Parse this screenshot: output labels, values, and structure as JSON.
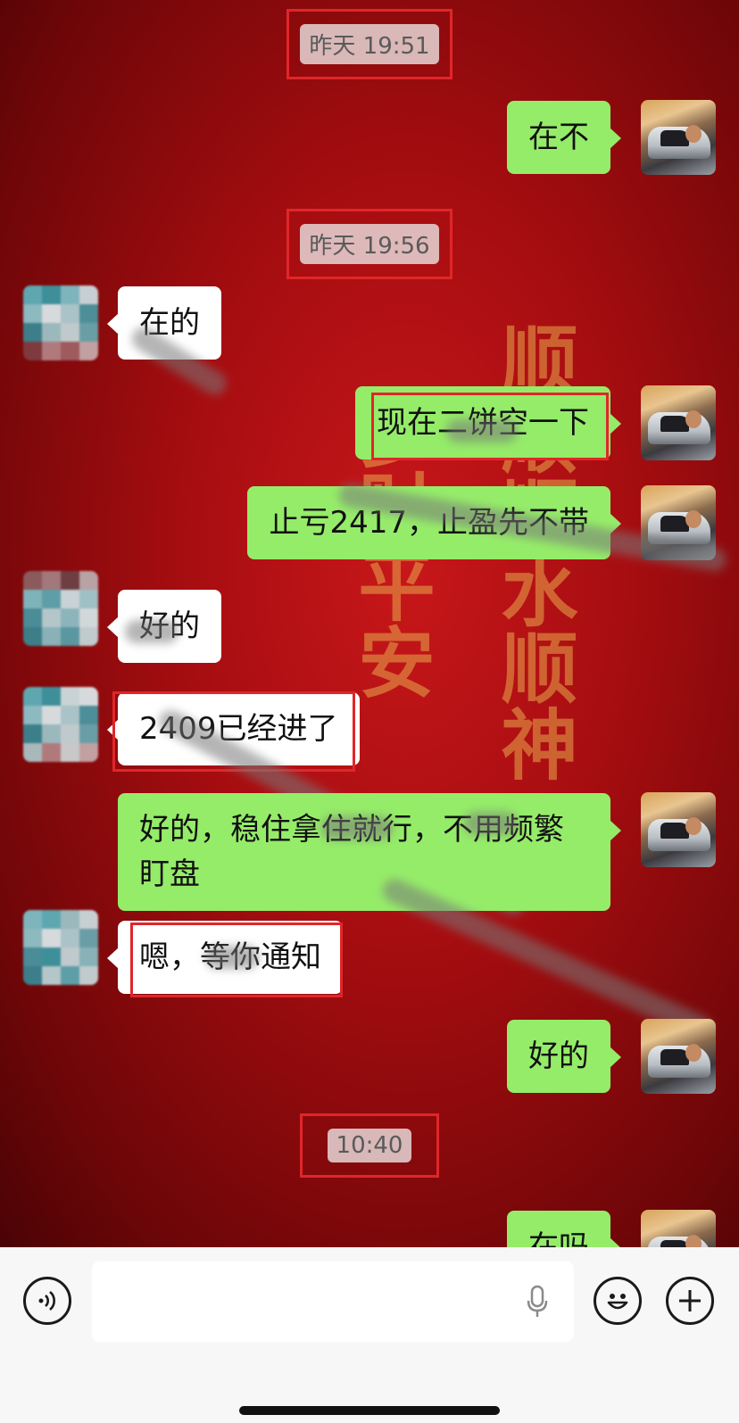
{
  "chat": {
    "timestamps": [
      "昨天 19:51",
      "昨天 19:56",
      "10:40"
    ],
    "messages": [
      {
        "sender": "self",
        "text": "在不"
      },
      {
        "sender": "other",
        "text": "在的"
      },
      {
        "sender": "self",
        "text": "现在二饼空一下"
      },
      {
        "sender": "self",
        "text": "止亏2417，止盈先不带"
      },
      {
        "sender": "other",
        "text": "好的"
      },
      {
        "sender": "other",
        "text": "2409已经进了"
      },
      {
        "sender": "self",
        "text": "好的，稳住拿住就行，不用频繁盯盘"
      },
      {
        "sender": "other",
        "text": "嗯，等你通知"
      },
      {
        "sender": "self",
        "text": "好的"
      },
      {
        "sender": "self",
        "text": "在吗"
      }
    ],
    "wallpaper": {
      "column1": "顺顺顺水顺神",
      "column2": "多财平安"
    }
  },
  "input_bar": {
    "voice_icon": "voice-icon",
    "mic_icon": "microphone-icon",
    "emoji_icon": "emoji-icon",
    "plus_icon": "plus-icon"
  },
  "colors": {
    "bubble_self": "#95ec69",
    "bubble_other": "#ffffff",
    "highlight_box": "#e0262a"
  }
}
